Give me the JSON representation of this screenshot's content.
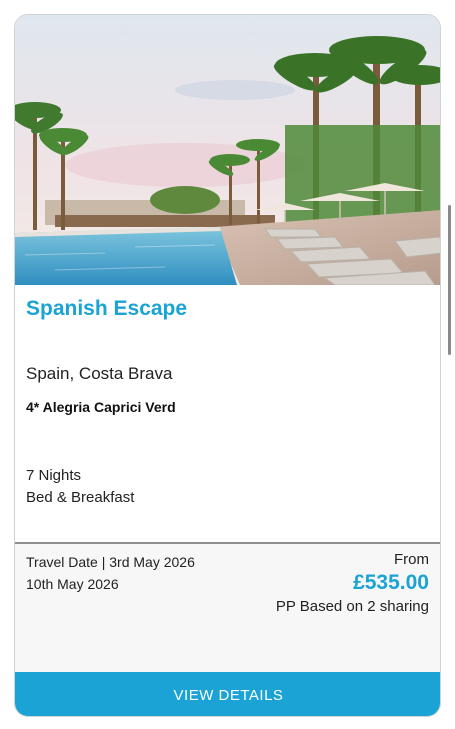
{
  "card": {
    "title": "Spanish Escape",
    "location": "Spain, Costa Brava",
    "hotel": "4* Alegria Caprici Verd",
    "nights": "7 Nights",
    "board": "Bed & Breakfast",
    "travel_date": "Travel Date | 3rd May 2026",
    "return_date": "10th May 2026",
    "price_from_label": "From",
    "price": "£535.00",
    "price_note": "PP Based on 2 sharing",
    "cta_label": "VIEW DETAILS"
  },
  "colors": {
    "accent": "#1aa3d4",
    "border": "#cfd3d6",
    "divider": "#8e8e8e"
  }
}
